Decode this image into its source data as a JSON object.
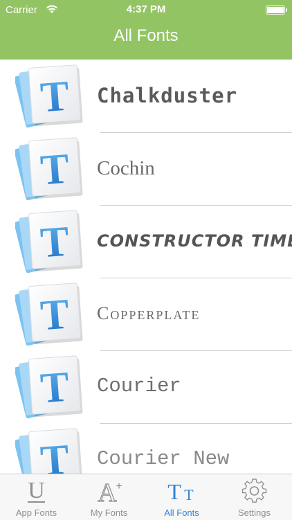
{
  "status_bar": {
    "carrier": "Carrier",
    "time": "4:37 PM"
  },
  "nav": {
    "title": "All Fonts"
  },
  "colors": {
    "nav_background": "#93c463",
    "tab_active": "#2e86d9",
    "tab_inactive": "#8e8e93"
  },
  "fonts": [
    {
      "name": "Chalkduster",
      "icon": "font-file-icon"
    },
    {
      "name": "Cochin",
      "icon": "font-file-icon"
    },
    {
      "name": "CONSTRUCTOR TIME",
      "icon": "font-file-icon"
    },
    {
      "name": "Copperplate",
      "icon": "font-file-icon"
    },
    {
      "name": "Courier",
      "icon": "font-file-icon"
    },
    {
      "name": "Courier New",
      "icon": "font-file-icon"
    }
  ],
  "tabbar": {
    "items": [
      {
        "label": "App Fonts",
        "icon": "underline-u-icon",
        "active": false
      },
      {
        "label": "My Fonts",
        "icon": "font-add-icon",
        "active": false
      },
      {
        "label": "All Fonts",
        "icon": "text-size-icon",
        "active": true
      },
      {
        "label": "Settings",
        "icon": "gear-icon",
        "active": false
      }
    ]
  }
}
